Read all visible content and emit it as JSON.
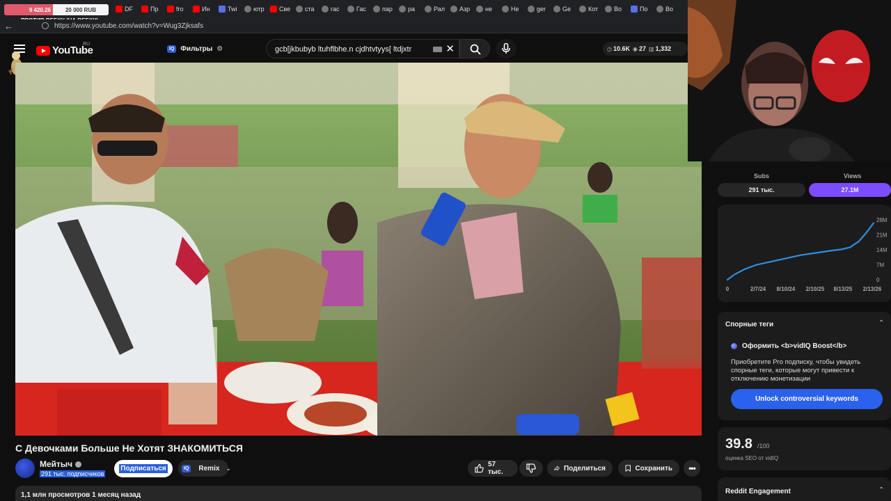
{
  "browser": {
    "donation": {
      "current": "9 420.26",
      "goal": "20 000 RUB",
      "caption": "ПРОТИВ ВЕБКУ (НА ВЕБКУ)"
    },
    "tabs": [
      "DF",
      "Пр",
      "fro",
      "Ин",
      "Twi",
      "ютр",
      "Све",
      "ста",
      "гас",
      "Гас",
      "пар",
      "ра",
      "Рал",
      "Азр",
      "не",
      "Не",
      "ger",
      "Ge",
      "Кот",
      "Во",
      "По",
      "Во"
    ],
    "url": "https://www.youtube.com/watch?v=Wug3Zjksafs"
  },
  "header": {
    "logo_text": "YouTube",
    "region": "RU",
    "filters_badge": "IQ",
    "filters_label": "Фильтры",
    "search_query": "gcb[jkbubyb ltuhflbhe.n cjdhtvtyys[ ltdjxtr",
    "stats": {
      "views": "10.6K",
      "eye": "27",
      "third": "1,332"
    }
  },
  "video": {
    "title": "С Девочками Больше Не Хотят ЗНАКОМИТЬСЯ",
    "channel": "Мейтыч",
    "subscribers": "291 тыс. подписчиков",
    "subscribe_label": "Подписаться",
    "remix_badge": "IQ",
    "remix_label": "Remix",
    "likes": "57 тыс.",
    "share_label": "Поделиться",
    "save_label": "Сохранить",
    "views_line": "1,1 млн просмотров  1 месяц назад"
  },
  "vidiq": {
    "subs_label": "Subs",
    "views_label": "Views",
    "subs_value": "291 тыс.",
    "views_value": "27.1M",
    "chart_data": {
      "type": "line",
      "x": [
        "2/7/24",
        "8/10/24",
        "2/10/25",
        "8/13/25",
        "2/13/26"
      ],
      "y_ticks": [
        "28M",
        "21M",
        "14M",
        "7M",
        "0"
      ],
      "x_ticks": [
        "0",
        "2/7/24",
        "8/10/24",
        "2/10/25",
        "8/13/25",
        "2/13/26"
      ],
      "ylim": [
        0,
        28
      ],
      "ylabel_unit": "M"
    },
    "tags_title": "Спорные теги",
    "boost_label": "Оформить <b>vidIQ Boost</b>",
    "tags_text": "Приобретите Pro подписку, чтобы увидеть спорные теги, которые могут привести к отключению монетизации",
    "unlock_label": "Unlock controversial keywords",
    "seo_score": "39.8",
    "seo_max": "/100",
    "seo_label": "оценка SEO от vidIQ",
    "reddit_label": "Reddit Engagement"
  },
  "colors": {
    "accent": "#7b4dff",
    "blue": "#2a62ee",
    "bg": "#0f0f0f",
    "chart_line": "#2f8fe0"
  }
}
